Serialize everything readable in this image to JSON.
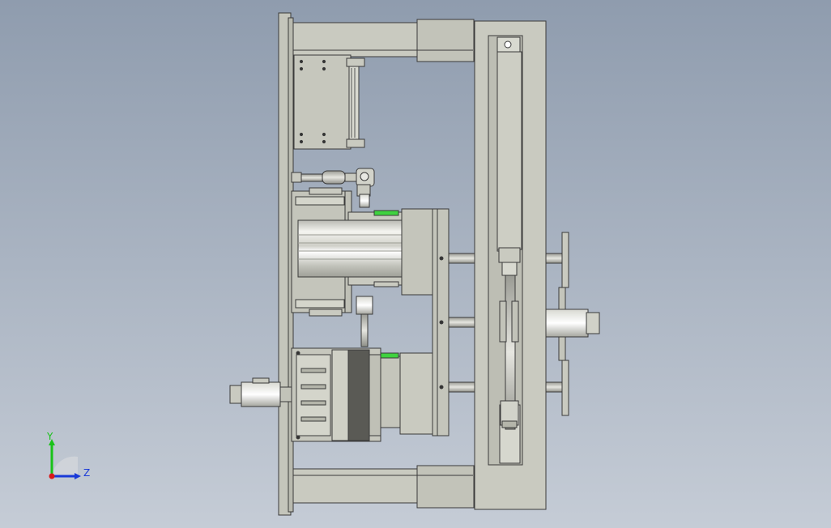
{
  "viewport": {
    "background_top": "#8f9cae",
    "background_bottom": "#c5ccd6"
  },
  "model": {
    "frame_color": "#c9cac0",
    "frame_dark": "#b4b5aa",
    "outline_color": "#3a3a3a",
    "accent_green": "#3fd23f",
    "dark_block": "#5a5a55"
  },
  "triad": {
    "y_label": "Y",
    "z_label": "Z",
    "y_color": "#19c219",
    "z_color": "#1a3ad8",
    "x_color": "#d81a1a"
  }
}
